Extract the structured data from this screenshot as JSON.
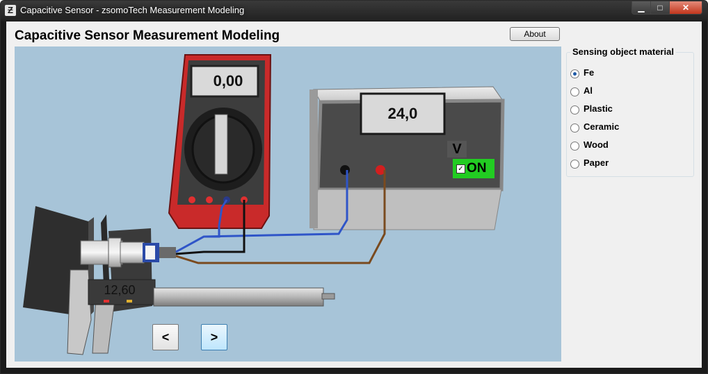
{
  "window": {
    "title": "Capacitive Sensor - zsomoTech Measurement Modeling",
    "app_icon_glyph": "Ƶ",
    "controls": {
      "minimize": "▁",
      "maximize": "□",
      "close": "✕"
    }
  },
  "header": {
    "title": "Capacitive Sensor Measurement Modeling",
    "about_label": "About"
  },
  "scene": {
    "multimeter_value": "0,00",
    "power_supply_value": "24,0",
    "power_supply_unit": "V",
    "power_switch": {
      "label": "ON",
      "checked": true,
      "check_glyph": "✓"
    },
    "caliper_value": "12,60",
    "prev_label": "<",
    "next_label": ">"
  },
  "material_panel": {
    "title": "Sensing object material",
    "options": [
      {
        "label": "Fe",
        "selected": true
      },
      {
        "label": "Al",
        "selected": false
      },
      {
        "label": "Plastic",
        "selected": false
      },
      {
        "label": "Ceramic",
        "selected": false
      },
      {
        "label": "Wood",
        "selected": false
      },
      {
        "label": "Paper",
        "selected": false
      }
    ]
  },
  "colors": {
    "scene_background": "#a7c4d8",
    "multimeter_body": "#c92a2a",
    "switch_on": "#22cc22",
    "wire_blue": "#2f55c8",
    "wire_brown": "#7a4a1e",
    "wire_black": "#111111"
  }
}
